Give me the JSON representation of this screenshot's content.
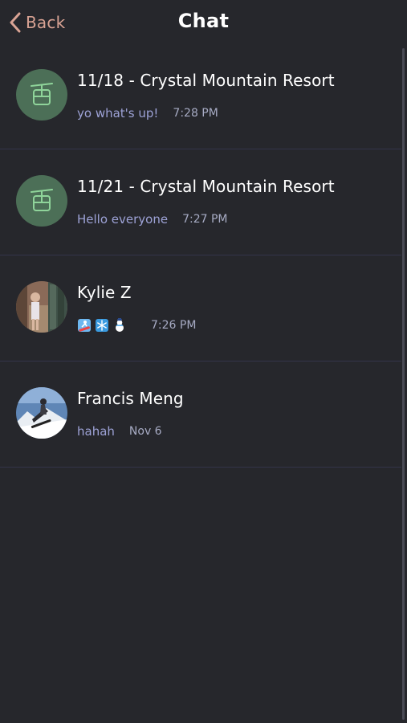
{
  "header": {
    "back_label": "Back",
    "title": "Chat"
  },
  "chats": [
    {
      "avatar": "gondola-icon",
      "title": "11/18 - Crystal Mountain Resort",
      "preview": "yo what's up!",
      "time": "7:28 PM"
    },
    {
      "avatar": "gondola-icon",
      "title": "11/21 - Crystal Mountain Resort",
      "preview": "Hello everyone",
      "time": "7:27 PM"
    },
    {
      "avatar": "user-photo",
      "title": "Kylie Z",
      "preview_icons": [
        "snowboard-icon",
        "snowflake-icon",
        "snowman-icon"
      ],
      "time": "7:26 PM"
    },
    {
      "avatar": "user-photo",
      "title": "Francis Meng",
      "preview": "hahah",
      "time": "Nov 6"
    }
  ],
  "colors": {
    "background": "#26272c",
    "accent": "#d9a394",
    "preview_text": "#9da2d6",
    "group_avatar": "#4c6f57",
    "gondola": "#8fd49a"
  }
}
